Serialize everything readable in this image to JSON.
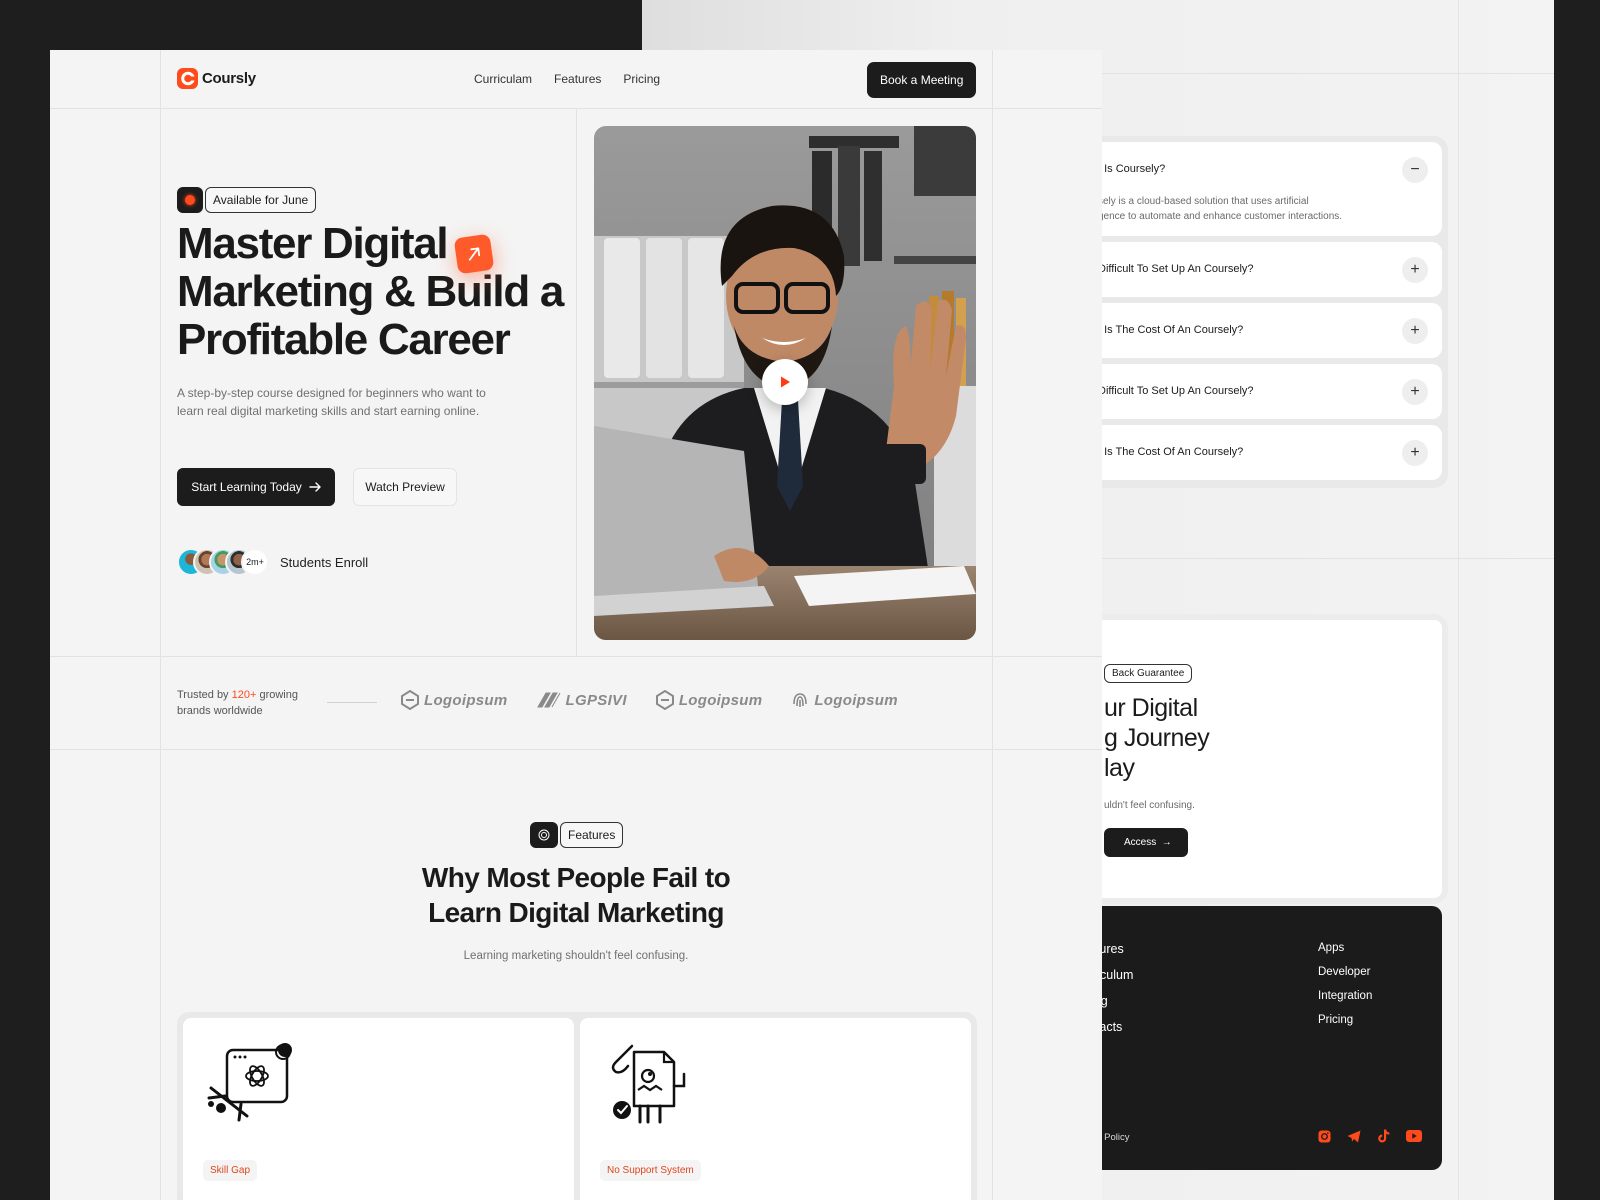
{
  "faq": {
    "items": [
      {
        "question": "t Is Coursely?",
        "answer": "sely is a cloud-based solution that uses artificial\ngence to automate and enhance customer interactions.",
        "toggle": "−"
      },
      {
        "question": "Difficult To Set Up An Coursely?",
        "toggle": "+"
      },
      {
        "question": "t Is The Cost Of An Coursely?",
        "toggle": "+"
      },
      {
        "question": "Difficult To Set Up An Coursely?",
        "toggle": "+"
      },
      {
        "question": "t Is The Cost Of An Coursely?",
        "toggle": "+"
      }
    ]
  },
  "cta": {
    "badge": "Back Guarantee",
    "title_line1": "ur Digital",
    "title_line2": "g Journey",
    "title_line3": "lay",
    "subtitle": "uldn't feel confusing.",
    "button": "Access"
  },
  "footer": {
    "col1": [
      "eatures",
      "urriculum",
      "icing",
      "ontacts"
    ],
    "col2": [
      "Apps",
      "Developer",
      "Integration",
      "Pricing"
    ],
    "privacy": "vacy Policy",
    "social_icons": [
      "instagram-icon",
      "telegram-icon",
      "tiktok-icon",
      "youtube-icon"
    ],
    "social_color": "#ff4a1c"
  },
  "header": {
    "brand": "Coursly",
    "nav": [
      "Curriculam",
      "Features",
      "Pricing"
    ],
    "cta": "Book a Meeting"
  },
  "hero": {
    "availability": "Available for June",
    "title": "Master Digital Marketing & Build a Profitable Career",
    "subtitle": "A step-by-step course designed for beginners who want to learn real digital marketing skills and start earning online.",
    "primary_button": "Start Learning Today",
    "secondary_button": "Watch Preview",
    "students_count": "2m+",
    "students_label": "Students Enroll",
    "accent": "#ff4a1c"
  },
  "trusted": {
    "prefix": "Trusted by ",
    "count": "120+",
    "suffix": " growing brands worldwide",
    "logos": [
      "Logoipsum",
      "LGPSIVI",
      "Logoipsum",
      "Logoipsum"
    ]
  },
  "features": {
    "badge": "Features",
    "title_line1": "Why Most People Fail to",
    "title_line2": "Learn Digital Marketing",
    "subtitle": "Learning marketing shouldn't feel confusing.",
    "cards": [
      {
        "tag": "Skill Gap",
        "icon": "skill-gap-illustration"
      },
      {
        "tag": "No Support System",
        "icon": "no-support-illustration"
      }
    ]
  }
}
